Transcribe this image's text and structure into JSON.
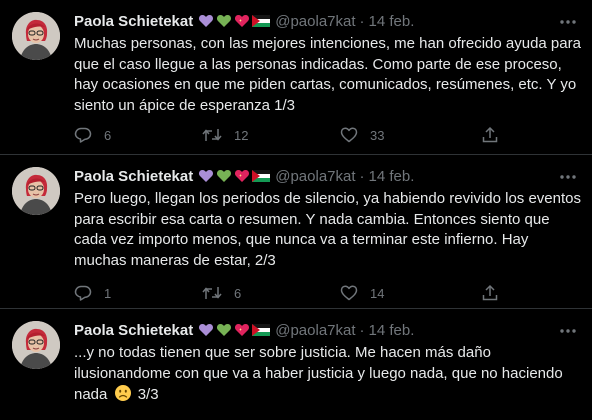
{
  "colors": {
    "background": "#000000",
    "text": "#e7e9ea",
    "muted": "#71767b",
    "divider": "#2f3336"
  },
  "icons": {
    "more": "more-horizontal-icon",
    "reply": "reply-icon",
    "retweet": "retweet-icon",
    "like": "heart-outline-icon",
    "share": "share-upload-icon",
    "name_emojis": [
      "purple-heart-icon",
      "green-heart-icon",
      "sparkling-heart-icon",
      "palestine-flag-icon"
    ]
  },
  "tweets": [
    {
      "author": {
        "name": "Paola Schietekat",
        "handle": "@paola7kat"
      },
      "separator": "·",
      "date": "14 feb.",
      "text": "Muchas personas, con las mejores intenciones, me han ofrecido ayuda para que el caso llegue a las personas indicadas. Como parte de ese proceso, hay ocasiones en que me piden cartas, comunicados, resúmenes, etc. Y yo siento un ápice de esperanza 1/3",
      "replies": "6",
      "retweets": "12",
      "likes": "33"
    },
    {
      "author": {
        "name": "Paola Schietekat",
        "handle": "@paola7kat"
      },
      "separator": "·",
      "date": "14 feb.",
      "text": "Pero luego, llegan los periodos de silencio, ya habiendo revivido los eventos para escribir esa carta o resumen. Y nada cambia. Entonces siento que cada vez importo menos, que nunca va a terminar este infierno. Hay muchas maneras de estar, 2/3",
      "replies": "1",
      "retweets": "6",
      "likes": "14"
    },
    {
      "author": {
        "name": "Paola Schietekat",
        "handle": "@paola7kat"
      },
      "separator": "·",
      "date": "14 feb.",
      "text_before_emoji": "...y no todas tienen que ser sobre justicia. Me hacen más daño ilusionandome con que va a haber justicia y luego nada, que no haciendo nada",
      "text_emoji": "slightly-frowning-face-icon",
      "text_after_emoji": "3/3"
    }
  ]
}
